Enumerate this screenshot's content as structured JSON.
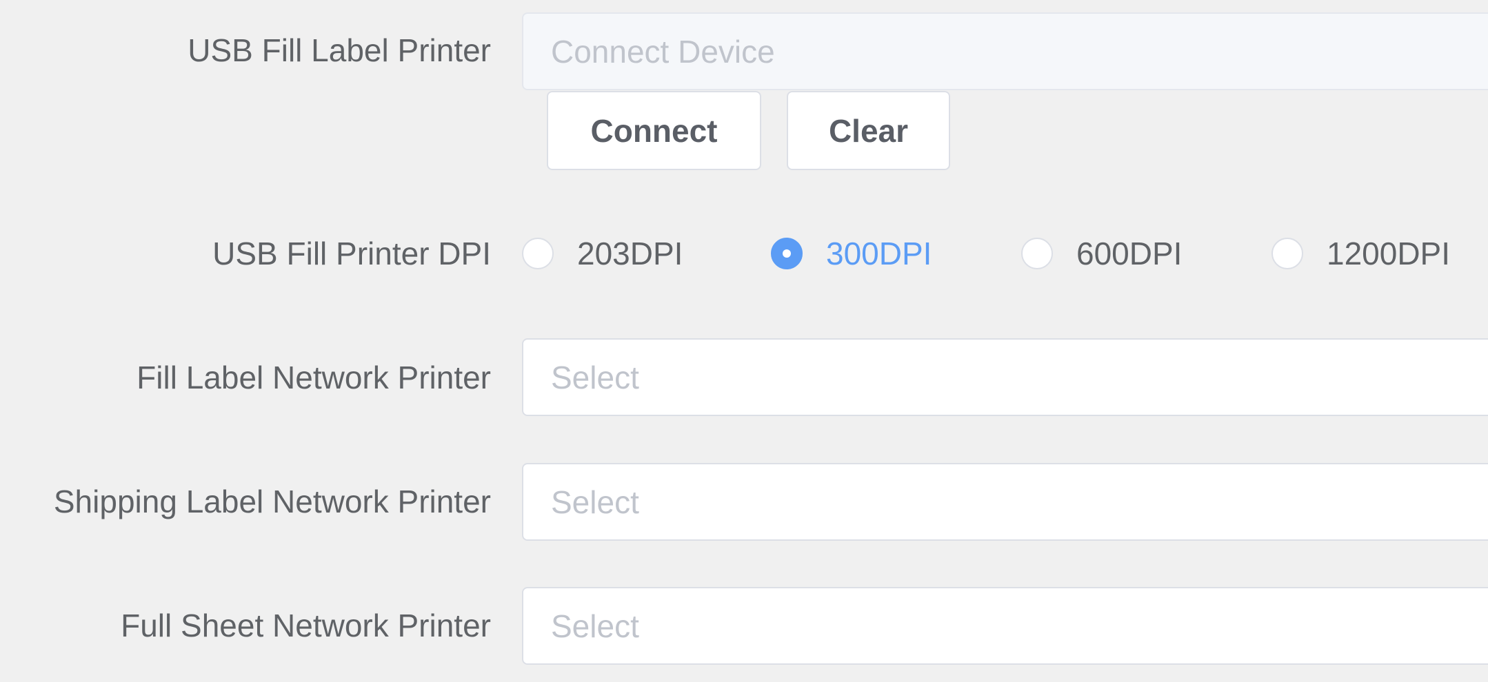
{
  "form": {
    "usb_fill_label_printer": {
      "label": "USB Fill Label Printer",
      "placeholder": "Connect Device",
      "connect_button": "Connect",
      "clear_button": "Clear"
    },
    "usb_fill_printer_dpi": {
      "label": "USB Fill Printer DPI",
      "options": [
        "203DPI",
        "300DPI",
        "600DPI",
        "1200DPI"
      ],
      "selected": "300DPI"
    },
    "fill_label_network_printer": {
      "label": "Fill Label Network Printer",
      "placeholder": "Select"
    },
    "shipping_label_network_printer": {
      "label": "Shipping Label Network Printer",
      "placeholder": "Select"
    },
    "full_sheet_network_printer": {
      "label": "Full Sheet Network Printer",
      "placeholder": "Select"
    }
  },
  "colors": {
    "background": "#f0f0f0",
    "accent": "#5b9cf5",
    "label_text": "#5f6266",
    "placeholder_text": "#c0c4cc",
    "border": "#dcdfe6"
  }
}
